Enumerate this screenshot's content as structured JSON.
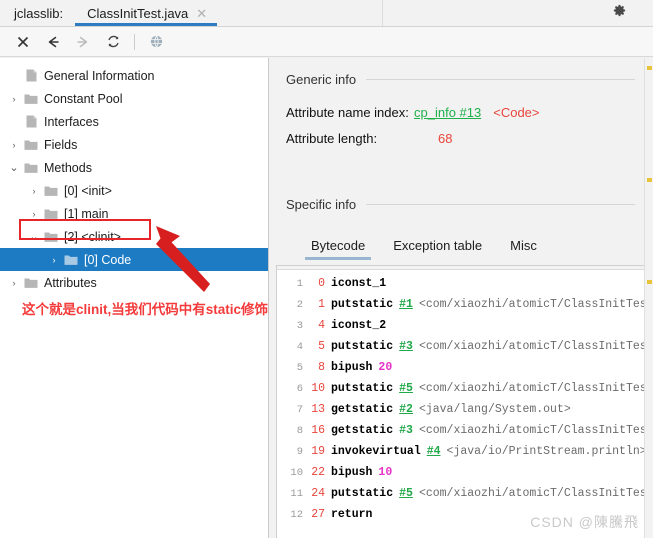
{
  "titlebar": {
    "app_label": "jclasslib:",
    "tab_name": "ClassInitTest.java",
    "close_glyph": "✕",
    "gear_icon": "gear-icon",
    "minimize_icon": "minimize-icon"
  },
  "toolbar": {
    "buttons": [
      {
        "name": "close-icon",
        "glyph": "✕",
        "color": "#333333"
      },
      {
        "name": "back-icon",
        "glyph": "←",
        "color": "#333333"
      },
      {
        "name": "forward-icon",
        "glyph": "→",
        "color": "#b8b8b8"
      },
      {
        "name": "reload-icon",
        "glyph": "↻",
        "color": "#444444"
      },
      {
        "name": "globe-icon",
        "glyph": "●",
        "color": "#9aa7b0"
      }
    ]
  },
  "tree": {
    "items": [
      {
        "label": "General Information",
        "indent": 0,
        "arrow": "",
        "icon": "file-icon",
        "selected": false
      },
      {
        "label": "Constant Pool",
        "indent": 0,
        "arrow": "›",
        "icon": "folder-icon",
        "selected": false
      },
      {
        "label": "Interfaces",
        "indent": 0,
        "arrow": "",
        "icon": "file-icon",
        "selected": false
      },
      {
        "label": "Fields",
        "indent": 0,
        "arrow": "›",
        "icon": "folder-icon",
        "selected": false
      },
      {
        "label": "Methods",
        "indent": 0,
        "arrow": "⌄",
        "icon": "folder-icon",
        "selected": false
      },
      {
        "label": "[0] <init>",
        "indent": 1,
        "arrow": "›",
        "icon": "folder-icon",
        "selected": false
      },
      {
        "label": "[1] main",
        "indent": 1,
        "arrow": "›",
        "icon": "folder-icon",
        "selected": false
      },
      {
        "label": "[2] <clinit>",
        "indent": 1,
        "arrow": "⌄",
        "icon": "folder-icon",
        "selected": false
      },
      {
        "label": "[0] Code",
        "indent": 2,
        "arrow": "›",
        "icon": "folder-icon",
        "selected": true
      },
      {
        "label": "Attributes",
        "indent": 0,
        "arrow": "›",
        "icon": "folder-icon",
        "selected": false
      }
    ]
  },
  "annotation": {
    "text": "这个就是clinit,当我们代码中有static修饰的变量或者代码快时会出现",
    "color": "#f43b3b",
    "highlight_box_color": "#e8252a",
    "arrow_color": "#d81f1f"
  },
  "generic_info": {
    "heading": "Generic info",
    "rows": [
      {
        "key": "Attribute name index:",
        "link": "cp_info #13",
        "note": "<Code>"
      },
      {
        "key": "Attribute length:",
        "value": "68"
      }
    ]
  },
  "specific_info": {
    "heading": "Specific info",
    "tabs": [
      {
        "label": "Bytecode",
        "active": true
      },
      {
        "label": "Exception table",
        "active": false
      },
      {
        "label": "Misc",
        "active": false
      }
    ]
  },
  "bytecode": {
    "lines": [
      {
        "num": "1",
        "offset": "0",
        "op": "iconst_1",
        "ref": "",
        "arg": "",
        "lit": ""
      },
      {
        "num": "2",
        "offset": "1",
        "op": "putstatic",
        "ref": "#1",
        "arg": "<com/xiaozhi/atomicT/ClassInitTest.",
        "lit": ""
      },
      {
        "num": "3",
        "offset": "4",
        "op": "iconst_2",
        "ref": "",
        "arg": "",
        "lit": ""
      },
      {
        "num": "4",
        "offset": "5",
        "op": "putstatic",
        "ref": "#3",
        "arg": "<com/xiaozhi/atomicT/ClassInitTest.",
        "lit": ""
      },
      {
        "num": "5",
        "offset": "8",
        "op": "bipush",
        "ref": "",
        "arg": "",
        "lit": "20"
      },
      {
        "num": "6",
        "offset": "10",
        "op": "putstatic",
        "ref": "#5",
        "arg": "<com/xiaozhi/atomicT/ClassInitTest.",
        "lit": ""
      },
      {
        "num": "7",
        "offset": "13",
        "op": "getstatic",
        "ref": "#2",
        "arg": "<java/lang/System.out>",
        "lit": ""
      },
      {
        "num": "8",
        "offset": "16",
        "op": "getstatic",
        "ref": "#3",
        "arg": "<com/xiaozhi/atomicT/ClassInitTest.",
        "lit": "",
        "ref_plain": true
      },
      {
        "num": "9",
        "offset": "19",
        "op": "invokevirtual",
        "ref": "#4",
        "arg": "<java/io/PrintStream.println>",
        "lit": ""
      },
      {
        "num": "10",
        "offset": "22",
        "op": "bipush",
        "ref": "",
        "arg": "",
        "lit": "10"
      },
      {
        "num": "11",
        "offset": "24",
        "op": "putstatic",
        "ref": "#5",
        "arg": "<com/xiaozhi/atomicT/ClassInitTest.",
        "lit": ""
      },
      {
        "num": "12",
        "offset": "27",
        "op": "return",
        "ref": "",
        "arg": "",
        "lit": ""
      }
    ]
  },
  "watermark": "CSDN @陳騰飛"
}
